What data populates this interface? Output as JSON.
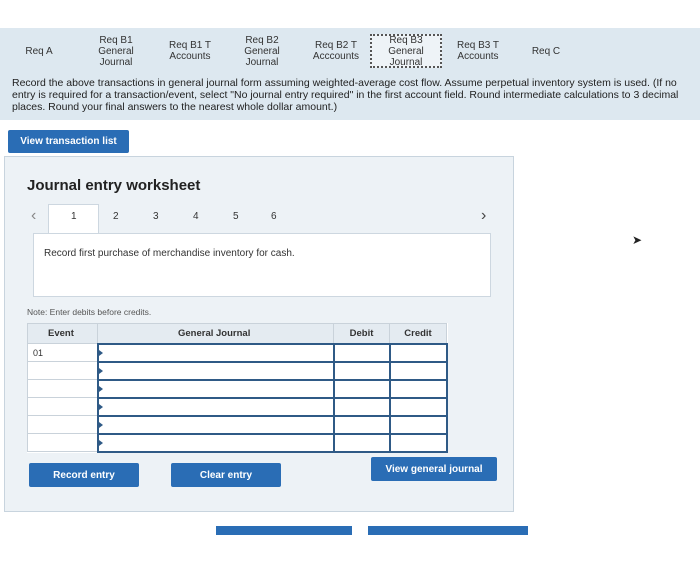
{
  "tabs": [
    {
      "label": "Req A"
    },
    {
      "label": "Req B1 General Journal"
    },
    {
      "label": "Req B1 T Accounts"
    },
    {
      "label": "Req B2 General Journal"
    },
    {
      "label": "Req B2 T Acccounts"
    },
    {
      "label": "Req B3 General Journal"
    },
    {
      "label": "Req B3 T Accounts"
    },
    {
      "label": "Req C"
    }
  ],
  "instructions": "Record the above transactions in general journal form assuming weighted-average cost flow. Assume perpetual inventory system is used. (If no entry is required for a transaction/event, select \"No journal entry required\" in the first account field. Round intermediate calculations to 3 decimal places. Round your final answers to the nearest whole dollar amount.)",
  "view_transaction_list": "View transaction list",
  "worksheet": {
    "title": "Journal entry worksheet",
    "pages": [
      "1",
      "2",
      "3",
      "4",
      "5",
      "6"
    ],
    "prompt": "Record first purchase of merchandise inventory for cash.",
    "note": "Note: Enter debits before credits.",
    "columns": {
      "event": "Event",
      "general_journal": "General Journal",
      "debit": "Debit",
      "credit": "Credit"
    },
    "rows": [
      {
        "event": "01"
      },
      {
        "event": ""
      },
      {
        "event": ""
      },
      {
        "event": ""
      },
      {
        "event": ""
      },
      {
        "event": ""
      }
    ],
    "record_entry": "Record entry",
    "clear_entry": "Clear entry",
    "view_general_journal": "View general journal"
  },
  "colors": {
    "accent": "#2a6db5",
    "tabbar": "#dde8f0"
  }
}
